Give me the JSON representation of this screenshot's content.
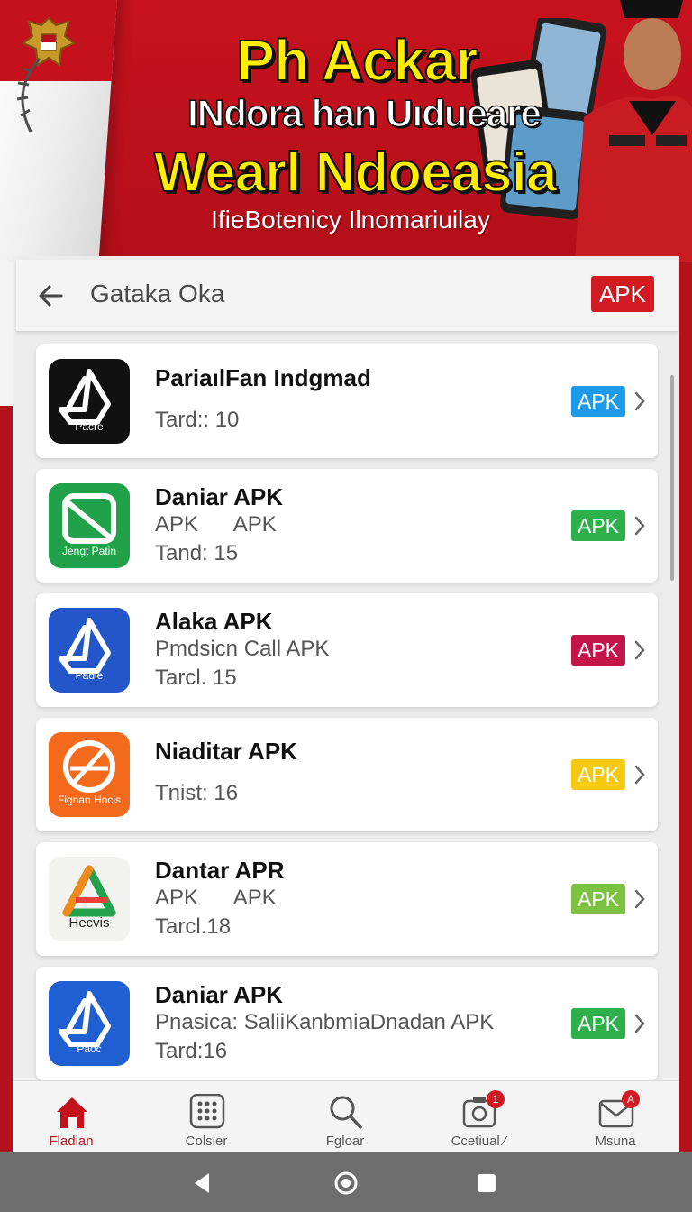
{
  "banner": {
    "line1": "Ph Ackar",
    "line2": "INdora han Uıdueare",
    "line3": "Wearl Ndoeasia",
    "line4": "IfieBotenicy Ilnomariuilay"
  },
  "appbar": {
    "title": "Gataka Oka",
    "badge": "APK"
  },
  "apps": [
    {
      "name": "PariaılFan Indgmad",
      "sub": "",
      "meta": "Tard:: 10",
      "icon_text": "Pacre",
      "icon": "apk-a-icon",
      "badge": "APK",
      "badge_color": "#1e9be8",
      "icon_color": "#111111"
    },
    {
      "name": "Daniar APK",
      "sub": "APK      APK",
      "meta": "Tand: 15",
      "icon_text": "Jengt Patin",
      "icon": "apk-square-icon",
      "badge": "APK",
      "badge_color": "#2db04a",
      "icon_color": "#21a24a"
    },
    {
      "name": "Alaka APK",
      "sub": "Pmdsicn Call APK",
      "meta": "Tarcl. 15",
      "icon_text": "Padie",
      "icon": "apk-a-icon",
      "badge": "APK",
      "badge_color": "#c4154a",
      "icon_color": "#2357c9"
    },
    {
      "name": "Niaditar APK",
      "sub": "",
      "meta": "Tnist: 16",
      "icon_text": "Fignan Hocis",
      "icon": "apk-circle-icon",
      "badge": "APK",
      "badge_color": "#f5c90f",
      "icon_color": "#f36a1d"
    },
    {
      "name": "Dantar APR",
      "sub": "APK      APK",
      "meta": "Tarcl.18",
      "icon_text": "Hecvis",
      "icon": "apk-triangle-icon",
      "badge": "APK",
      "badge_color": "#7cc142",
      "icon_color": "#f2f2ee"
    },
    {
      "name": "Daniar APK",
      "sub": "Pnasica: SaliiKanbmiaDnadan APK",
      "meta": "Tard:16",
      "icon_text": "Paoc",
      "icon": "apk-a-icon",
      "badge": "APK",
      "badge_color": "#2db04a",
      "icon_color": "#1f5fd1"
    }
  ],
  "bottom_nav": [
    {
      "label": "Fladian",
      "icon": "home-icon",
      "active": true
    },
    {
      "label": "Colsier",
      "icon": "grid-icon",
      "active": false
    },
    {
      "label": "Fgloar",
      "icon": "search-icon",
      "active": false
    },
    {
      "label": "Ccetiual ⁄",
      "icon": "camera-icon",
      "active": false,
      "badge": "1"
    },
    {
      "label": "Msuna",
      "icon": "mail-icon",
      "active": false,
      "badge": "A"
    }
  ],
  "colors": {
    "brand_red": "#c4111b",
    "title_yellow": "#ffee00"
  }
}
